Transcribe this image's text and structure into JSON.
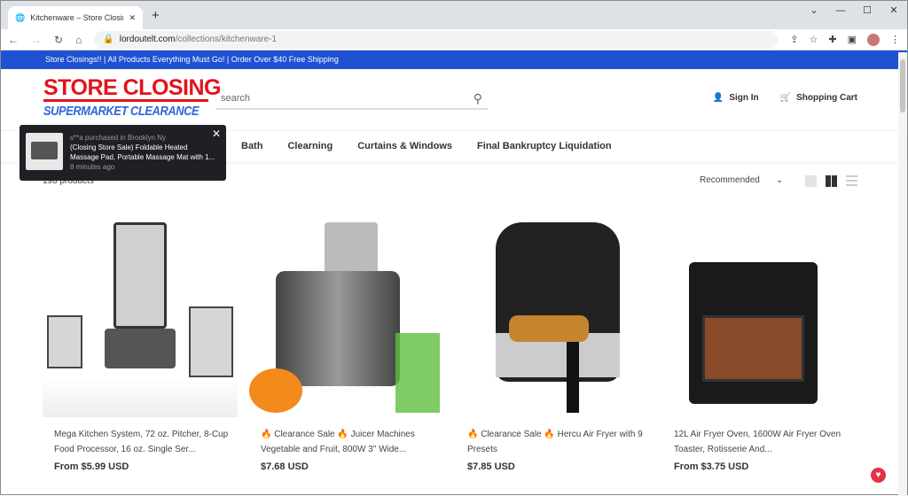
{
  "browser": {
    "tab_title": "Kitchenware – Store Closing Wa",
    "url_domain": "lordoutelt.com",
    "url_path": "/collections/kitchenware-1"
  },
  "announcement": "Store Closings!! | All Products Everything Must Go! | Order Over $40 Free Shipping",
  "logo": {
    "line1": "STORE CLOSING",
    "line2": "SUPERMARKET CLEARANCE"
  },
  "search": {
    "placeholder": "search"
  },
  "header": {
    "sign_in": "Sign In",
    "cart": "Shopping Cart"
  },
  "nav": [
    "Bath",
    "Clearning",
    "Curtains & Windows",
    "Final Bankruptcy Liquidation"
  ],
  "toast": {
    "who": "s**a purchased in Brooklyn Ny",
    "product": "(Closing Store Sale) Foldable Heated Massage Pad, Portable Massage Mat with 1...",
    "time": "8 minutes ago"
  },
  "collection": {
    "count": "198 products",
    "sort": "Recommended"
  },
  "products": [
    {
      "title": "Mega Kitchen System, 72 oz. Pitcher, 8-Cup Food Processor, 16 oz. Single Ser...",
      "price": "From $5.99 USD"
    },
    {
      "title": "🔥 Clearance Sale 🔥 Juicer Machines Vegetable and Fruit, 800W 3\" Wide...",
      "price": "$7.68 USD"
    },
    {
      "title": "🔥 Clearance Sale 🔥 Hercu Air Fryer with 9 Presets",
      "price": "$7.85 USD"
    },
    {
      "title": "12L Air Fryer Oven, 1600W Air Fryer Oven Toaster, Rotisserie And...",
      "price": "From $3.75 USD"
    }
  ],
  "colors": {
    "announce": "#1f51d3",
    "logo_red": "#e3131b",
    "logo_blue": "#2e66d8"
  }
}
